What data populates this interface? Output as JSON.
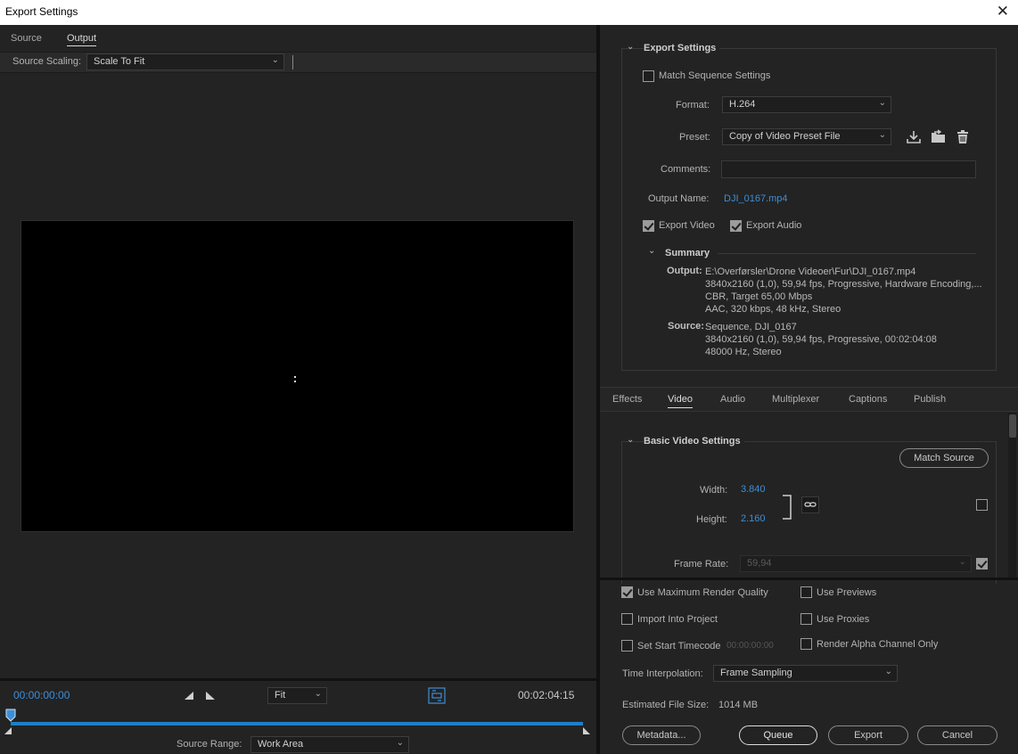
{
  "window": {
    "title": "Export Settings",
    "close": "✕"
  },
  "left": {
    "tabs": [
      "Source",
      "Output"
    ],
    "scaling_label": "Source Scaling:",
    "scaling_value": "Scale To Fit",
    "timecode_start": "00:00:00:00",
    "timecode_end": "00:02:04:15",
    "zoom_value": "Fit",
    "source_range_label": "Source Range:",
    "source_range_value": "Work Area"
  },
  "export_settings": {
    "header": "Export Settings",
    "match_sequence": "Match Sequence Settings",
    "format_label": "Format:",
    "format_value": "H.264",
    "preset_label": "Preset:",
    "preset_value": "Copy of Video Preset File",
    "comments_label": "Comments:",
    "comments_value": "",
    "output_name_label": "Output Name:",
    "output_name_value": "DJI_0167.mp4",
    "export_video": "Export Video",
    "export_audio": "Export Audio"
  },
  "summary": {
    "header": "Summary",
    "output_label": "Output:",
    "output_lines": [
      "E:\\Overførsler\\Drone Videoer\\Fur\\DJI_0167.mp4",
      "3840x2160 (1,0), 59,94 fps, Progressive, Hardware Encoding,...",
      "CBR, Target 65,00 Mbps",
      "AAC, 320 kbps, 48 kHz, Stereo"
    ],
    "source_label": "Source:",
    "source_lines": [
      "Sequence, DJI_0167",
      "3840x2160 (1,0), 59,94 fps, Progressive, 00:02:04:08",
      "48000 Hz, Stereo"
    ]
  },
  "settings_tabs": [
    "Effects",
    "Video",
    "Audio",
    "Multiplexer",
    "Captions",
    "Publish"
  ],
  "video": {
    "header": "Basic Video Settings",
    "match_source": "Match Source",
    "width_label": "Width:",
    "width_value": "3.840",
    "height_label": "Height:",
    "height_value": "2.160",
    "frame_rate_label": "Frame Rate:",
    "frame_rate_value": "59,94"
  },
  "bottom": {
    "max_render": "Use Maximum Render Quality",
    "use_previews": "Use Previews",
    "import_project": "Import Into Project",
    "use_proxies": "Use Proxies",
    "set_start_tc": "Set Start Timecode",
    "start_tc_value": "00:00:00:00",
    "render_alpha": "Render Alpha Channel Only",
    "time_interp_label": "Time Interpolation:",
    "time_interp_value": "Frame Sampling",
    "est_size_label": "Estimated File Size:",
    "est_size_value": "1014 MB",
    "buttons": {
      "metadata": "Metadata...",
      "queue": "Queue",
      "export": "Export",
      "cancel": "Cancel"
    }
  }
}
